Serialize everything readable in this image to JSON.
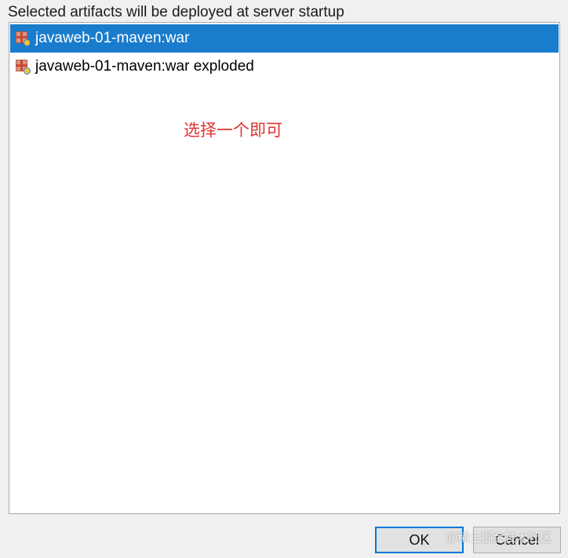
{
  "header": {
    "label": "Selected artifacts will be deployed at server startup"
  },
  "artifacts": [
    {
      "label": "javaweb-01-maven:war",
      "selected": true,
      "icon": "war-artifact-icon"
    },
    {
      "label": "javaweb-01-maven:war exploded",
      "selected": false,
      "icon": "war-artifact-icon"
    }
  ],
  "annotation": {
    "text": "选择一个即可",
    "color": "#e0332f"
  },
  "buttons": {
    "ok_label": "OK",
    "cancel_label": "Cancel"
  },
  "watermark": {
    "text": "@稀土掘金技术社区"
  },
  "colors": {
    "selection": "#1a7ccc",
    "ok_focus": "#0078d7"
  }
}
